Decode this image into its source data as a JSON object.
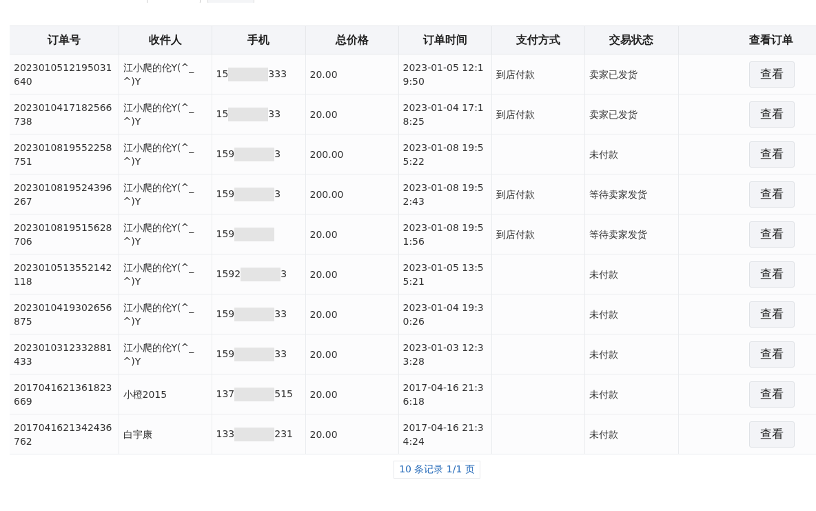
{
  "columns": [
    "订单号",
    "收件人",
    "手机",
    "总价格",
    "订单时间",
    "支付方式",
    "交易状态",
    "查看订单"
  ],
  "rows": [
    {
      "order_no": "2023010512195031640",
      "recipient": "江小爬的伦Y(^_^)Y",
      "phone_start": "15",
      "phone_end": "333",
      "total": "20.00",
      "time": "2023-01-05 12:19:50",
      "payment": "到店付款",
      "status": "卖家已发货",
      "action": "查看"
    },
    {
      "order_no": "2023010417182566738",
      "recipient": "江小爬的伦Y(^_^)Y",
      "phone_start": "15",
      "phone_end": "33",
      "total": "20.00",
      "time": "2023-01-04 17:18:25",
      "payment": "到店付款",
      "status": "卖家已发货",
      "action": "查看"
    },
    {
      "order_no": "2023010819552258751",
      "recipient": "江小爬的伦Y(^_^)Y",
      "phone_start": "159",
      "phone_end": "3",
      "total": "200.00",
      "time": "2023-01-08 19:55:22",
      "status": "未付款",
      "action": "查看"
    },
    {
      "order_no": "2023010819524396267",
      "recipient": "江小爬的伦Y(^_^)Y",
      "phone_start": "159",
      "phone_end": "3",
      "total": "200.00",
      "time": "2023-01-08 19:52:43",
      "payment": "到店付款",
      "status": "等待卖家发货",
      "action": "查看"
    },
    {
      "order_no": "2023010819515628706",
      "recipient": "江小爬的伦Y(^_^)Y",
      "phone_start": "159",
      "total": "20.00",
      "time": "2023-01-08 19:51:56",
      "payment": "到店付款",
      "status": "等待卖家发货",
      "action": "查看"
    },
    {
      "order_no": "2023010513552142118",
      "recipient": "江小爬的伦Y(^_^)Y",
      "phone_start": "1592",
      "phone_end": "3",
      "total": "20.00",
      "time": "2023-01-05 13:55:21",
      "status": "未付款",
      "action": "查看"
    },
    {
      "order_no": "2023010419302656875",
      "recipient": "江小爬的伦Y(^_^)Y",
      "phone_start": "159",
      "phone_end": "33",
      "total": "20.00",
      "time": "2023-01-04 19:30:26",
      "status": "未付款",
      "action": "查看"
    },
    {
      "order_no": "2023010312332881433",
      "recipient": "江小爬的伦Y(^_^)Y",
      "phone_start": "159",
      "phone_end": "33",
      "total": "20.00",
      "time": "2023-01-03 12:33:28",
      "status": "未付款",
      "action": "查看"
    },
    {
      "order_no": "2017041621361823669",
      "recipient": "小橙2015",
      "phone_start": "137",
      "phone_end": "515",
      "total": "20.00",
      "time": "2017-04-16 21:36:18",
      "status": "未付款",
      "action": "查看"
    },
    {
      "order_no": "2017041621342436762",
      "recipient": "白宇康",
      "phone_start": "133",
      "phone_end": "231",
      "total": "20.00",
      "time": "2017-04-16 21:34:24",
      "status": "未付款",
      "action": "查看"
    }
  ],
  "pagination": "10 条记录 1/1 页"
}
